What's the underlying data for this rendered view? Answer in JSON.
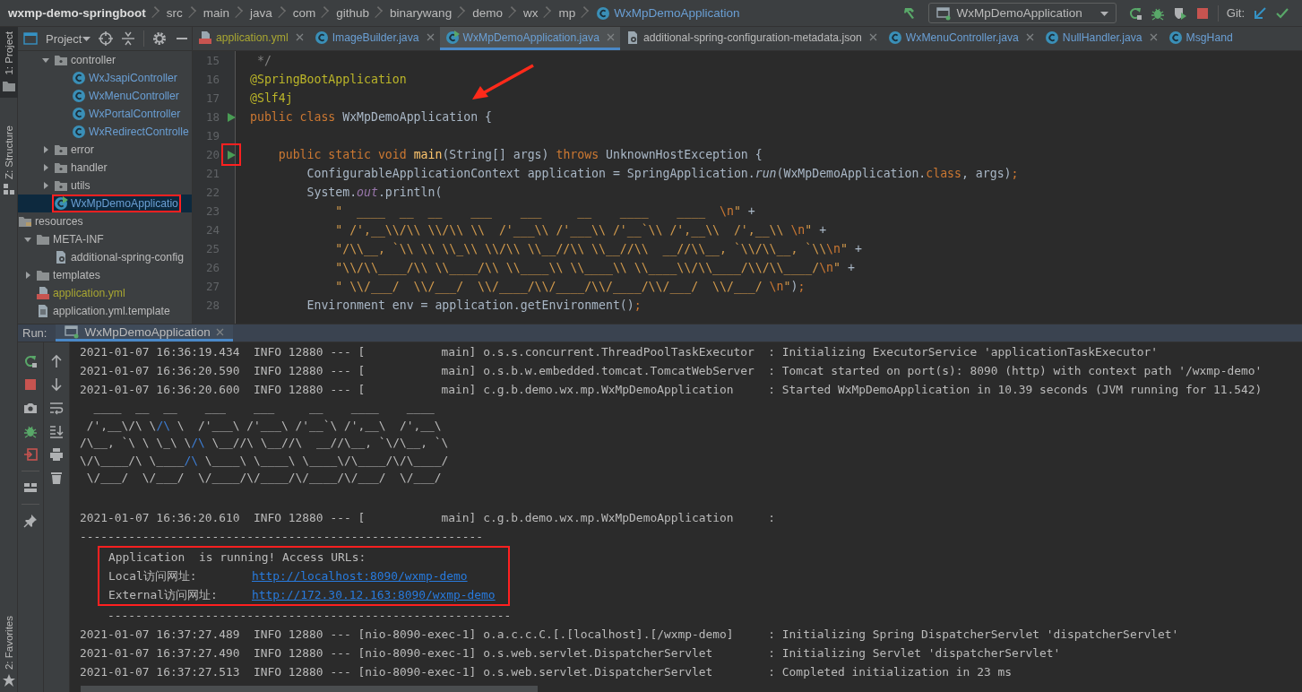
{
  "breadcrumb": {
    "items": [
      "wxmp-demo-springboot",
      "src",
      "main",
      "java",
      "com",
      "github",
      "binarywang",
      "demo",
      "wx",
      "mp"
    ],
    "current": "WxMpDemoApplication"
  },
  "toolbar": {
    "run_config": "WxMpDemoApplication",
    "git_label": "Git:"
  },
  "side_strip": {
    "top": [
      {
        "label": "1: Project",
        "kind": "folder",
        "selected": true
      },
      {
        "label": "Z: Structure",
        "kind": "struct",
        "selected": false
      }
    ],
    "bottom": [
      {
        "label": "2: Favorites",
        "kind": "star",
        "selected": false
      }
    ]
  },
  "project_panel": {
    "title": "Project",
    "tree": [
      {
        "children": [
          {
            "children": [
              {
                "label": "controller",
                "kind": "package",
                "expanded": true,
                "selected": false,
                "highlighted": false,
                "children": [
                  {
                    "label": "WxJsapiController",
                    "kind": "class",
                    "selected": false,
                    "highlighted": false
                  },
                  {
                    "label": "WxMenuController",
                    "kind": "class",
                    "selected": false,
                    "highlighted": false
                  },
                  {
                    "label": "WxPortalController",
                    "kind": "class",
                    "selected": false,
                    "highlighted": false
                  },
                  {
                    "label": "WxRedirectControlle",
                    "kind": "class",
                    "selected": false,
                    "highlighted": false
                  }
                ]
              },
              {
                "label": "error",
                "kind": "package",
                "expanded": false,
                "selected": false,
                "highlighted": false
              },
              {
                "label": "handler",
                "kind": "package",
                "expanded": false,
                "selected": false,
                "highlighted": false
              },
              {
                "label": "utils",
                "kind": "package",
                "expanded": false,
                "selected": false,
                "highlighted": false
              },
              {
                "label": "WxMpDemoApplicatio",
                "kind": "app",
                "selected": true,
                "highlighted": true
              }
            ]
          }
        ]
      },
      {
        "label": "resources",
        "kind": "resources",
        "selected": false,
        "highlighted": false,
        "children": [
          {
            "label": "META-INF",
            "kind": "folder",
            "expanded": true,
            "selected": false,
            "highlighted": false,
            "children": [
              {
                "label": "additional-spring-config",
                "kind": "json",
                "selected": false,
                "highlighted": false
              }
            ]
          },
          {
            "label": "templates",
            "kind": "folder",
            "expanded": false,
            "selected": false,
            "highlighted": false
          },
          {
            "label": "application.yml",
            "kind": "yml",
            "selected": false,
            "highlighted": false
          },
          {
            "label": "application.yml.template",
            "kind": "file",
            "selected": false,
            "highlighted": false
          }
        ]
      }
    ]
  },
  "editor": {
    "tabs": [
      {
        "label": "application.yml",
        "kind": "yml",
        "color": "#a8a632",
        "selected": false,
        "closable": true
      },
      {
        "label": "ImageBuilder.java",
        "kind": "class",
        "color": "#6a9fd4",
        "selected": false,
        "closable": true
      },
      {
        "label": "WxMpDemoApplication.java",
        "kind": "app",
        "color": "#6a9fd4",
        "selected": true,
        "closable": true
      },
      {
        "label": "additional-spring-configuration-metadata.json",
        "kind": "json",
        "color": "#bbbbbb",
        "selected": false,
        "closable": true
      },
      {
        "label": "WxMenuController.java",
        "kind": "class",
        "color": "#6a9fd4",
        "selected": false,
        "closable": true
      },
      {
        "label": "NullHandler.java",
        "kind": "class",
        "color": "#6a9fd4",
        "selected": false,
        "closable": true
      },
      {
        "label": "MsgHand",
        "kind": "class",
        "color": "#6a9fd4",
        "selected": false,
        "closable": false
      }
    ],
    "arrow_annotation": true,
    "lines": [
      {
        "number": "15",
        "run_marker": false,
        "highlighted": false,
        "tokens": [
          {
            "kind": "comment",
            "text": " */"
          }
        ]
      },
      {
        "number": "16",
        "run_marker": false,
        "highlighted": false,
        "tokens": [
          {
            "kind": "annotation",
            "text": "@SpringBootApplication"
          }
        ]
      },
      {
        "number": "17",
        "run_marker": false,
        "highlighted": false,
        "tokens": [
          {
            "kind": "annotation",
            "text": "@Slf4j"
          }
        ]
      },
      {
        "number": "18",
        "run_marker": true,
        "highlighted": false,
        "tokens": [
          {
            "kind": "keyword",
            "text": "public class"
          },
          {
            "kind": "plain",
            "text": " WxMpDemoApplication {"
          }
        ]
      },
      {
        "number": "19",
        "run_marker": false,
        "highlighted": false
      },
      {
        "number": "20",
        "run_marker": true,
        "highlighted": true,
        "tokens": [
          {
            "kind": "keyword",
            "text": "    public static void "
          },
          {
            "kind": "method",
            "text": "main"
          },
          {
            "kind": "plain",
            "text": "(String[] args) "
          },
          {
            "kind": "keyword",
            "text": "throws"
          },
          {
            "kind": "plain",
            "text": " UnknownHostException {"
          }
        ]
      },
      {
        "number": "21",
        "run_marker": false,
        "highlighted": false,
        "tokens": [
          {
            "kind": "plain",
            "text": "        ConfigurableApplicationContext application = SpringApplication."
          },
          {
            "kind": "italic",
            "text": "run"
          },
          {
            "kind": "plain",
            "text": "(WxMpDemoApplication."
          },
          {
            "kind": "keyword",
            "text": "class"
          },
          {
            "kind": "plain",
            "text": ", args)"
          },
          {
            "kind": "keyword",
            "text": ";"
          }
        ]
      },
      {
        "number": "22",
        "run_marker": false,
        "highlighted": false,
        "tokens": [
          {
            "kind": "plain",
            "text": "        System."
          },
          {
            "kind": "field",
            "text": "out"
          },
          {
            "kind": "plain",
            "text": ".println("
          }
        ]
      },
      {
        "number": "23",
        "run_marker": false,
        "highlighted": false,
        "tokens": [
          {
            "kind": "string",
            "text": "            \"  ____  __  __    ___    ___     __    ____    ____  "
          },
          {
            "kind": "escape",
            "text": "\\n"
          },
          {
            "kind": "string",
            "text": "\""
          },
          {
            "kind": "plain",
            "text": " +"
          }
        ]
      },
      {
        "number": "24",
        "run_marker": false,
        "highlighted": false,
        "tokens": [
          {
            "kind": "string",
            "text": "            \" /',__\\\\/\\\\ \\\\/\\\\ \\\\  /'___\\\\ /'___\\\\ /'__`\\\\ /',__\\\\  /',__\\\\ "
          },
          {
            "kind": "escape",
            "text": "\\n"
          },
          {
            "kind": "string",
            "text": "\""
          },
          {
            "kind": "plain",
            "text": " +"
          }
        ]
      },
      {
        "number": "25",
        "run_marker": false,
        "highlighted": false,
        "tokens": [
          {
            "kind": "string",
            "text": "            \"/\\\\__, `\\\\ \\\\ \\\\_\\\\ \\\\/\\\\ \\\\__//\\\\ \\\\__//\\\\  __//\\\\__, `\\\\/\\\\__, `\\\\"
          },
          {
            "kind": "escape",
            "text": "\\n"
          },
          {
            "kind": "string",
            "text": "\""
          },
          {
            "kind": "plain",
            "text": " +"
          }
        ]
      },
      {
        "number": "26",
        "run_marker": false,
        "highlighted": false,
        "tokens": [
          {
            "kind": "string",
            "text": "            \"\\\\/\\\\____/\\\\ \\\\____/\\\\ \\\\____\\\\ \\\\____\\\\ \\\\____\\\\/\\\\____/\\\\/\\\\____/"
          },
          {
            "kind": "escape",
            "text": "\\n"
          },
          {
            "kind": "string",
            "text": "\""
          },
          {
            "kind": "plain",
            "text": " +"
          }
        ]
      },
      {
        "number": "27",
        "run_marker": false,
        "highlighted": false,
        "tokens": [
          {
            "kind": "string",
            "text": "            \" \\\\/___/  \\\\/___/  \\\\/____/\\\\/____/\\\\/____/\\\\/___/  \\\\/___/ "
          },
          {
            "kind": "escape",
            "text": "\\n"
          },
          {
            "kind": "string",
            "text": "\""
          },
          {
            "kind": "plain",
            "text": ")"
          },
          {
            "kind": "keyword",
            "text": ";"
          }
        ]
      },
      {
        "number": "28",
        "run_marker": false,
        "highlighted": false,
        "tokens": [
          {
            "kind": "plain",
            "text": "        Environment env = application.getEnvironment()"
          },
          {
            "kind": "keyword",
            "text": ";"
          }
        ]
      }
    ]
  },
  "run_panel": {
    "label": "Run:",
    "tab": {
      "label": "WxMpDemoApplication",
      "selected": true
    },
    "console": [
      {
        "kind": "log",
        "text": "2021-01-07 16:36:19.434  INFO 12880 --- [           main] o.s.s.concurrent.ThreadPoolTaskExecutor  : Initializing ExecutorService 'applicationTaskExecutor'"
      },
      {
        "kind": "log",
        "text": "2021-01-07 16:36:20.590  INFO 12880 --- [           main] o.s.b.w.embedded.tomcat.TomcatWebServer  : Tomcat started on port(s): 8090 (http) with context path '/wxmp-demo'"
      },
      {
        "kind": "log",
        "text": "2021-01-07 16:36:20.600  INFO 12880 --- [           main] c.g.b.demo.wx.mp.WxMpDemoApplication     : Started WxMpDemoApplication in 10.39 seconds (JVM running for 11.542)"
      },
      {
        "kind": "banner",
        "parts": [
          {
            "text": "  ____  __  __    ___    ___     __    ____    ____",
            "link": false
          }
        ]
      },
      {
        "kind": "banner",
        "parts": [
          {
            "text": " /',__\\/\\ \\",
            "link": false
          },
          {
            "text": "/\\",
            "link": true
          },
          {
            "text": " \\  /'___\\ /'___\\ /'__`\\ /',__\\  /',__\\",
            "link": false
          }
        ]
      },
      {
        "kind": "banner",
        "parts": [
          {
            "text": "/\\__, `\\ \\ \\_\\ \\",
            "link": false
          },
          {
            "text": "/\\",
            "link": true
          },
          {
            "text": " \\__//\\ \\__//\\  __//\\__, `\\/\\__, `\\",
            "link": false
          }
        ]
      },
      {
        "kind": "banner",
        "parts": [
          {
            "text": "\\/\\____/\\ \\____",
            "link": false
          },
          {
            "text": "/\\",
            "link": true
          },
          {
            "text": " \\____\\ \\____\\ \\____\\/\\____/\\/\\____/",
            "link": false
          }
        ]
      },
      {
        "kind": "banner",
        "parts": [
          {
            "text": " \\/___/  \\/___/  \\/____/\\/____/\\/____/\\/___/  \\/___/",
            "link": false
          }
        ]
      },
      {
        "kind": "blank"
      },
      {
        "kind": "log",
        "text": "2021-01-07 16:36:20.610  INFO 12880 --- [           main] c.g.b.demo.wx.mp.WxMpDemoApplication     :"
      },
      {
        "kind": "log",
        "text": "----------------------------------------------------------"
      },
      {
        "kind": "box",
        "highlighted": true,
        "lines": [
          {
            "text": "Application  is running! Access URLs:"
          },
          {
            "label": "Local访问网址:",
            "link": "http://localhost:8090/wxmp-demo"
          },
          {
            "label": "External访问网址:",
            "link": "http://172.30.12.163:8090/wxmp-demo"
          }
        ]
      },
      {
        "kind": "log",
        "text": "    ----------------------------------------------------------"
      },
      {
        "kind": "log",
        "text": "2021-01-07 16:37:27.489  INFO 12880 --- [nio-8090-exec-1] o.a.c.c.C.[.[localhost].[/wxmp-demo]     : Initializing Spring DispatcherServlet 'dispatcherServlet'"
      },
      {
        "kind": "log",
        "text": "2021-01-07 16:37:27.490  INFO 12880 --- [nio-8090-exec-1] o.s.web.servlet.DispatcherServlet        : Initializing Servlet 'dispatcherServlet'"
      },
      {
        "kind": "log",
        "text": "2021-01-07 16:37:27.513  INFO 12880 --- [nio-8090-exec-1] o.s.web.servlet.DispatcherServlet        : Completed initialization in 23 ms"
      }
    ]
  }
}
